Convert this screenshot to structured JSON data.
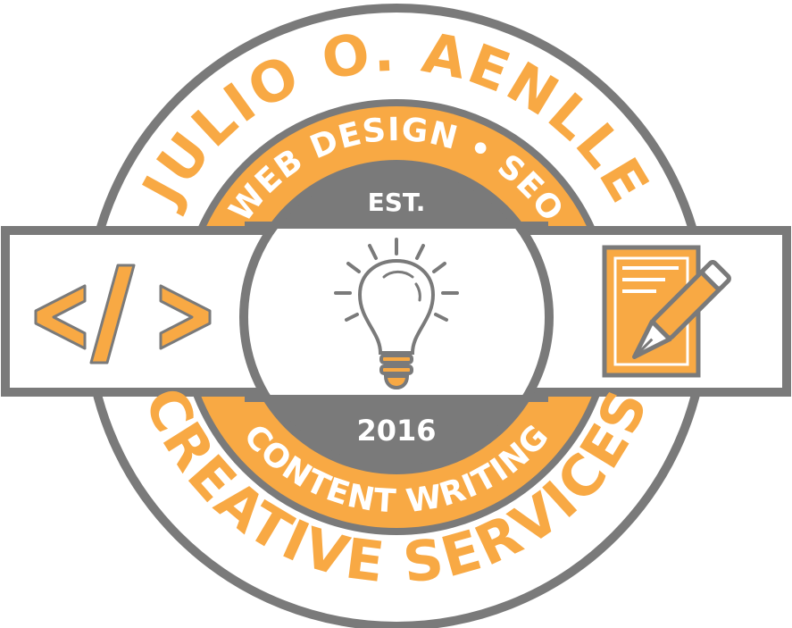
{
  "badge": {
    "name_text": "JULIO O. AENLLE",
    "top_band_text": "WEB DESIGN • SEO",
    "est_label": "EST.",
    "year": "2016",
    "bottom_band_text": "CONTENT WRITING",
    "bottom_text": "CREATIVE SERVICES"
  },
  "icons": {
    "left": "code-brackets-icon",
    "center": "lightbulb-icon",
    "right": "document-pen-icon"
  },
  "colors": {
    "accent": "#F8A944",
    "gray": "#7A7A7A",
    "light_gray": "#8C8C8C",
    "white": "#FFFFFF"
  }
}
